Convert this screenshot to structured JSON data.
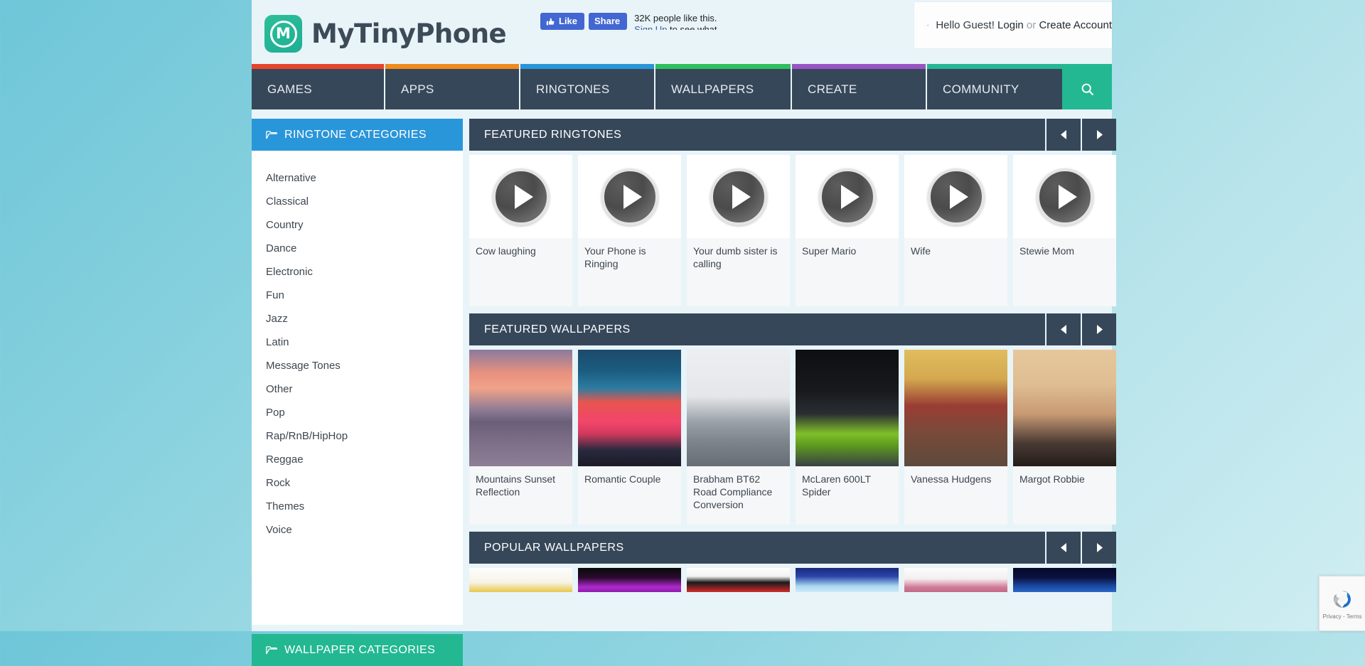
{
  "site": {
    "logo_letter": "M",
    "brand": "MyTinyPhone"
  },
  "facebook": {
    "like_label": "Like",
    "share_label": "Share",
    "social_prefix": "32K people like this.",
    "signup_link": "Sign Up",
    "social_suffix": "to see what your friends like."
  },
  "account": {
    "greeting": "Hello Guest!",
    "login_label": "Login",
    "or_label": "or",
    "create_label": "Create Account"
  },
  "nav": {
    "items": [
      {
        "label": "GAMES",
        "accent": "#e8452c"
      },
      {
        "label": "APPS",
        "accent": "#f08a1c"
      },
      {
        "label": "RINGTONES",
        "accent": "#2a96da"
      },
      {
        "label": "WALLPAPERS",
        "accent": "#2fbf5e"
      },
      {
        "label": "CREATE",
        "accent": "#9a54c4"
      },
      {
        "label": "COMMUNITY",
        "accent": "#23b892"
      }
    ],
    "search_icon": "search-icon"
  },
  "sidebar": {
    "ringtone_header": "RINGTONE CATEGORIES",
    "wallpaper_header": "WALLPAPER CATEGORIES",
    "categories": [
      "Alternative",
      "Classical",
      "Country",
      "Dance",
      "Electronic",
      "Fun",
      "Jazz",
      "Latin",
      "Message Tones",
      "Other",
      "Pop",
      "Rap/RnB/HipHop",
      "Reggae",
      "Rock",
      "Themes",
      "Voice"
    ]
  },
  "sections": {
    "featured_ringtones": {
      "title": "FEATURED RINGTONES",
      "prev_icon": "chevron-left-icon",
      "next_icon": "chevron-right-icon",
      "items": [
        {
          "title": "Cow laughing"
        },
        {
          "title": "Your Phone is Ringing"
        },
        {
          "title": "Your dumb sister is calling"
        },
        {
          "title": "Super Mario"
        },
        {
          "title": "Wife"
        },
        {
          "title": "Stewie Mom"
        }
      ]
    },
    "featured_wallpapers": {
      "title": "FEATURED WALLPAPERS",
      "prev_icon": "chevron-left-icon",
      "next_icon": "chevron-right-icon",
      "items": [
        {
          "title": "Mountains Sunset Reflection",
          "style": "wp-a"
        },
        {
          "title": "Romantic Couple",
          "style": "wp-b"
        },
        {
          "title": "Brabham BT62 Road Compliance Conversion",
          "style": "wp-c"
        },
        {
          "title": "McLaren 600LT Spider",
          "style": "wp-d"
        },
        {
          "title": "Vanessa Hudgens",
          "style": "wp-e"
        },
        {
          "title": "Margot Robbie",
          "style": "wp-f"
        }
      ]
    },
    "popular_wallpapers": {
      "title": "POPULAR WALLPAPERS",
      "prev_icon": "chevron-left-icon",
      "next_icon": "chevron-right-icon",
      "items": [
        {
          "style": "pw-a"
        },
        {
          "style": "pw-b"
        },
        {
          "style": "pw-c"
        },
        {
          "style": "pw-d"
        },
        {
          "style": "pw-e"
        },
        {
          "style": "pw-f"
        }
      ]
    }
  },
  "recaptcha": {
    "label": "Privacy - Terms",
    "icon": "recaptcha-icon"
  },
  "colors": {
    "page_bg": "#e8f4f8",
    "nav_bg": "#37475a",
    "accent_teal": "#23b892",
    "accent_blue": "#2a96da"
  }
}
